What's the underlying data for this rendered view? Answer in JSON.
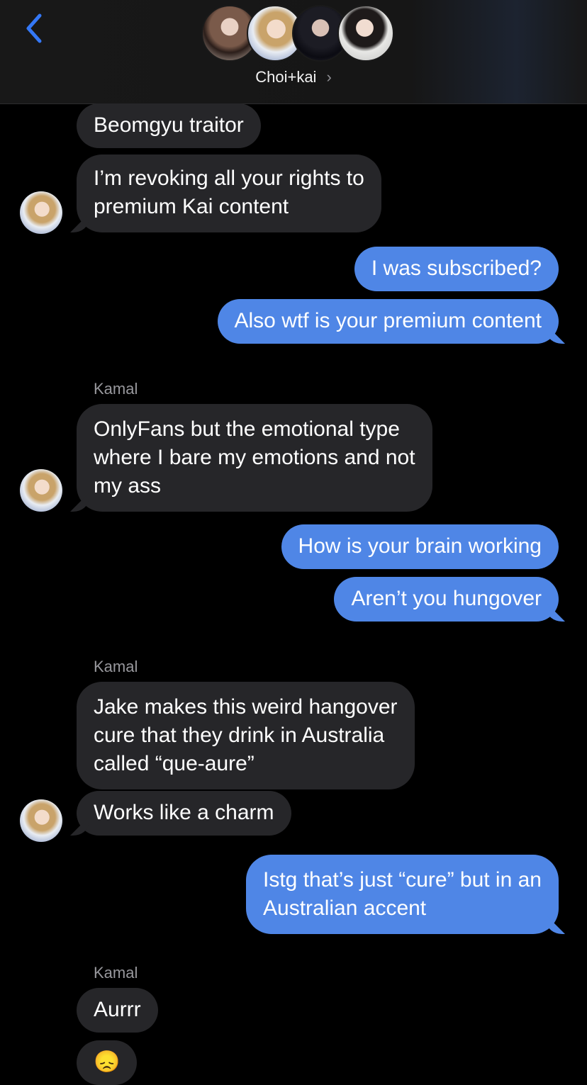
{
  "header": {
    "group_name": "Choi+kai",
    "chevron": "›",
    "back_icon": "chevron-left-icon"
  },
  "messages": [
    {
      "from": "other",
      "text": "Beomgyu traitor"
    },
    {
      "from": "other",
      "lines": [
        "I’m revoking all your rights to",
        "premium Kai content"
      ]
    },
    {
      "from": "me",
      "text": "I was subscribed?"
    },
    {
      "from": "me",
      "text": "Also wtf is your premium content"
    },
    {
      "sender": "Kamal"
    },
    {
      "from": "other",
      "lines": [
        "OnlyFans but the emotional type",
        "where I bare my emotions and not",
        "my ass"
      ]
    },
    {
      "from": "me",
      "text": "How is your brain working"
    },
    {
      "from": "me",
      "text": "Aren’t you hungover"
    },
    {
      "sender": "Kamal"
    },
    {
      "from": "other",
      "lines": [
        "Jake makes this weird hangover",
        "cure that they drink in Australia",
        "called “que-aure”"
      ]
    },
    {
      "from": "other",
      "text": "Works like a charm"
    },
    {
      "from": "me",
      "lines": [
        "Istg that’s just “cure” but in an",
        "Australian accent"
      ]
    },
    {
      "sender": "Kamal"
    },
    {
      "from": "other",
      "text": "Aurrr"
    },
    {
      "from": "other",
      "text": "😞"
    }
  ],
  "colors": {
    "sent_bubble": "#4f86e6",
    "received_bubble": "#262629",
    "background": "#000000",
    "accent": "#3478f6"
  }
}
